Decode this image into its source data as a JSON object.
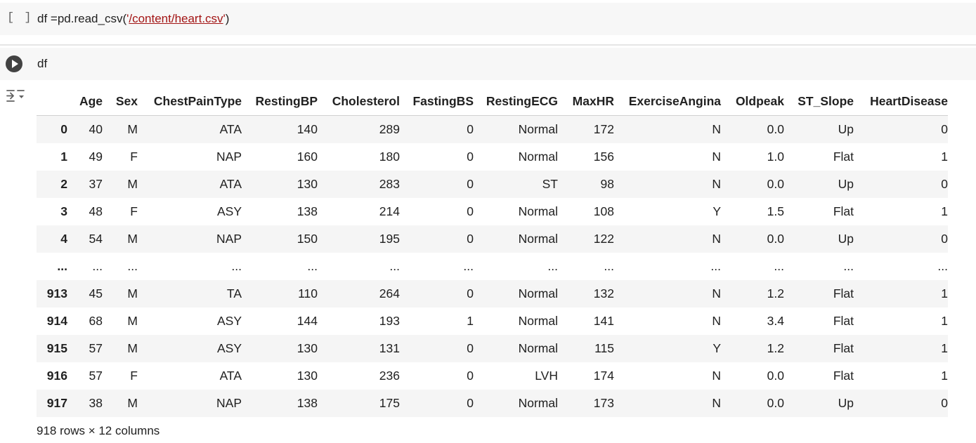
{
  "cell1": {
    "prompt": "[ ]",
    "code_prefix": "df =pd.read_csv(",
    "quote_open": "'",
    "path": "/content/heart.csv",
    "quote_close": "'",
    "code_suffix": ")"
  },
  "cell2": {
    "code": "df"
  },
  "table": {
    "columns": [
      "",
      "Age",
      "Sex",
      "ChestPainType",
      "RestingBP",
      "Cholesterol",
      "FastingBS",
      "RestingECG",
      "MaxHR",
      "ExerciseAngina",
      "Oldpeak",
      "ST_Slope",
      "HeartDisease"
    ],
    "rows": [
      [
        "0",
        "40",
        "M",
        "ATA",
        "140",
        "289",
        "0",
        "Normal",
        "172",
        "N",
        "0.0",
        "Up",
        "0"
      ],
      [
        "1",
        "49",
        "F",
        "NAP",
        "160",
        "180",
        "0",
        "Normal",
        "156",
        "N",
        "1.0",
        "Flat",
        "1"
      ],
      [
        "2",
        "37",
        "M",
        "ATA",
        "130",
        "283",
        "0",
        "ST",
        "98",
        "N",
        "0.0",
        "Up",
        "0"
      ],
      [
        "3",
        "48",
        "F",
        "ASY",
        "138",
        "214",
        "0",
        "Normal",
        "108",
        "Y",
        "1.5",
        "Flat",
        "1"
      ],
      [
        "4",
        "54",
        "M",
        "NAP",
        "150",
        "195",
        "0",
        "Normal",
        "122",
        "N",
        "0.0",
        "Up",
        "0"
      ],
      [
        "...",
        "...",
        "...",
        "...",
        "...",
        "...",
        "...",
        "...",
        "...",
        "...",
        "...",
        "...",
        "..."
      ],
      [
        "913",
        "45",
        "M",
        "TA",
        "110",
        "264",
        "0",
        "Normal",
        "132",
        "N",
        "1.2",
        "Flat",
        "1"
      ],
      [
        "914",
        "68",
        "M",
        "ASY",
        "144",
        "193",
        "1",
        "Normal",
        "141",
        "N",
        "3.4",
        "Flat",
        "1"
      ],
      [
        "915",
        "57",
        "M",
        "ASY",
        "130",
        "131",
        "0",
        "Normal",
        "115",
        "Y",
        "1.2",
        "Flat",
        "1"
      ],
      [
        "916",
        "57",
        "F",
        "ATA",
        "130",
        "236",
        "0",
        "LVH",
        "174",
        "N",
        "0.0",
        "Flat",
        "1"
      ],
      [
        "917",
        "38",
        "M",
        "NAP",
        "138",
        "175",
        "0",
        "Normal",
        "173",
        "N",
        "0.0",
        "Up",
        "0"
      ]
    ]
  },
  "summary": "918 rows × 12 columns",
  "icons": {
    "run": "play-circle-icon",
    "output_options": "output-options-icon"
  },
  "colors": {
    "cell_background": "#f7f7f7",
    "string_literal": "#a31515",
    "run_button": "#424242",
    "row_stripe": "#f5f5f5"
  }
}
